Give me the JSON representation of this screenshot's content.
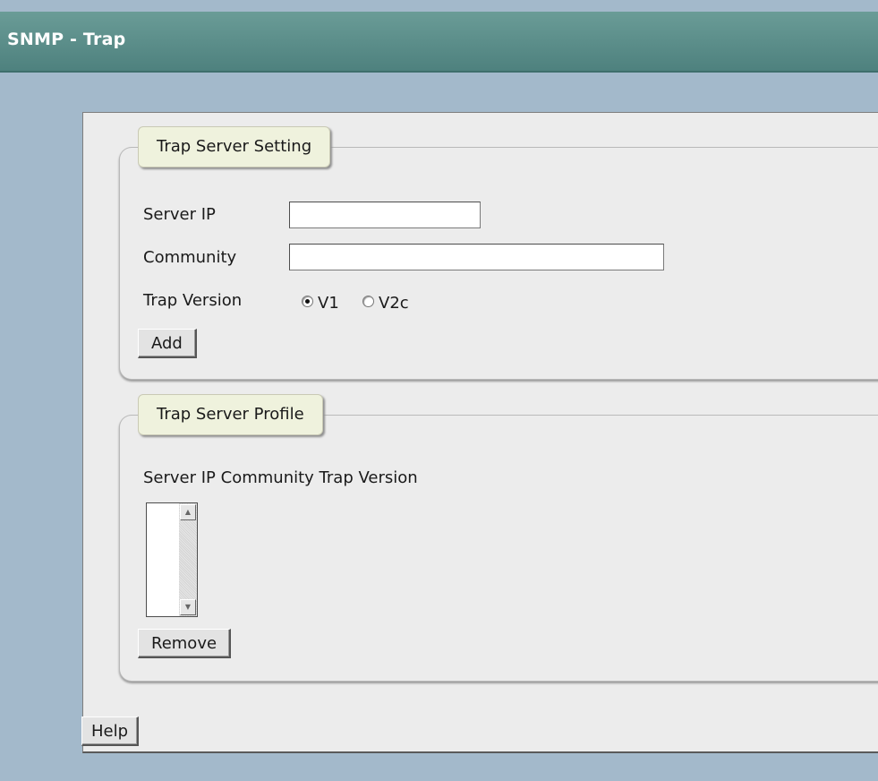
{
  "header": {
    "title": "SNMP - Trap"
  },
  "setting": {
    "legend": "Trap Server Setting",
    "server_ip_label": "Server IP",
    "server_ip_value": "",
    "community_label": "Community",
    "community_value": "",
    "trap_version_label": "Trap Version",
    "v1_label": "V1",
    "v2c_label": "V2c",
    "selected_version": "V1",
    "add_label": "Add"
  },
  "profile": {
    "legend": "Trap Server Profile",
    "columns_label": "Server IP Community Trap Version",
    "entries": [],
    "remove_label": "Remove"
  },
  "help_label": "Help",
  "icons": {
    "scroll_up": "scroll-up-arrow-icon",
    "scroll_down": "scroll-down-arrow-icon"
  },
  "colors": {
    "header": "#5a8c88",
    "background": "#a3b9cb",
    "panel": "#ececec",
    "legend": "#eff2dd"
  }
}
